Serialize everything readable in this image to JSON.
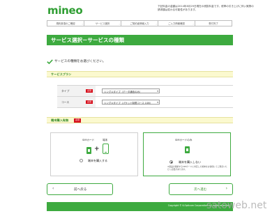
{
  "header": {
    "logo": "mineo",
    "note": "下記料金の金額は2014年8月29日現在の税抜料金です。税率の引き上げに伴い実際の請求額は変わる可能性があります。"
  },
  "steps": [
    {
      "label": "規約事項のご確認"
    },
    {
      "label": "サービス選択"
    },
    {
      "label": "ご契約者情報入力"
    },
    {
      "label": "ご入力情報確認"
    },
    {
      "label": "受付完了"
    }
  ],
  "page_title": "サービス選択－サービスの種類",
  "instruction": "サービスの種類をお選びください。",
  "service_plan": {
    "title": "サービスプラン",
    "rows": [
      {
        "label": "タイプ",
        "badge": "必須",
        "value": "シングルタイプ（データ通信のみ）"
      },
      {
        "label": "コース",
        "badge": "必須",
        "value": "シングルタイプ（パケット制限コース 1GB）"
      }
    ]
  },
  "device_purchase": {
    "title": "端末購入有無",
    "badge": "必須",
    "options": [
      {
        "sim_caption": "SIMカード",
        "device_caption": "端末",
        "label": "端末を購入する",
        "selected": false
      },
      {
        "sim_caption": "SIMカードのみ",
        "label": "端末を購入しない",
        "selected": true,
        "note": "※製品の開始するSIMカードに対応した端末をお客様にてご用意いただく必要があります。"
      }
    ]
  },
  "buttons": {
    "back_label": "前へ戻る",
    "next_label": "次へ進む"
  },
  "footer": {
    "copyright": "Copyright © K-Opticom Corporation. All rights reserved."
  },
  "watermark": "satoweb.net",
  "colors": {
    "brand_green": "#3daa3f",
    "required_red": "#d7101d",
    "section_bg": "#fbf9cf"
  }
}
